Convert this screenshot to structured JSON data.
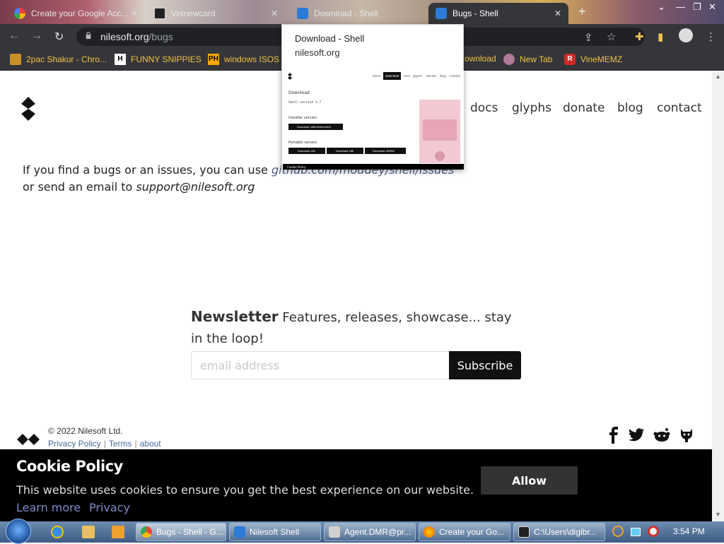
{
  "browser": {
    "tabs": [
      {
        "label": "Create your Google Acc...",
        "icon": "google-icon"
      },
      {
        "label": "Vetnewcard",
        "icon": "card-icon"
      },
      {
        "label": "Download - Shell",
        "icon": "shell-icon"
      },
      {
        "label": "Bugs - Shell",
        "icon": "shell-icon",
        "active": true
      }
    ],
    "url_host": "nilesoft.org",
    "url_path": "/bugs",
    "bookmarks": [
      {
        "label": "2pac Shakur - Chro...",
        "icon": "bookmark-icon"
      },
      {
        "label": "FUNNY SNIPPIES",
        "icon": "h-icon",
        "glyph": "H"
      },
      {
        "label": "windows ISOS",
        "icon": "ph-icon",
        "glyph": "PH"
      },
      {
        "label": "ownload",
        "icon": "bookmark-icon"
      },
      {
        "label": "New Tab",
        "icon": "newtab-icon"
      },
      {
        "label": "VineMEMZ",
        "icon": "r-icon",
        "glyph": "R"
      }
    ]
  },
  "preview": {
    "title": "Download - Shell",
    "host": "nilesoft.org",
    "thumb": {
      "nav": [
        "home",
        "download",
        "docs",
        "glyphs",
        "donate",
        "blog",
        "contact"
      ],
      "heading": "Download",
      "version": "Shell version 1.7",
      "installer_label": "Installer version",
      "installer_btn": "Download (x86/x64/arm64)",
      "portable_label": "Portable version",
      "portable_btns": [
        "Download x64",
        "Download x86",
        "Download ARM64"
      ],
      "cookie": "Cookie Policy"
    }
  },
  "site": {
    "nav": [
      "docs",
      "glyphs",
      "donate",
      "blog",
      "contact"
    ],
    "bug_text_1": "If you find a bugs or an issues, you can use ",
    "bug_link": "github.com/moudey/shell/issues",
    "bug_text_2": "or send an email to ",
    "bug_email": "support@nilesoft.org",
    "newsletter_title": "Newsletter",
    "newsletter_text": " Features, releases, showcase... stay in the loop!",
    "email_placeholder": "email address",
    "subscribe_label": "Subscribe",
    "copyright": "© 2022 Nilesoft Ltd.",
    "footer_links": [
      "Privacy Policy",
      "Terms",
      "about"
    ],
    "social": [
      "facebook-icon",
      "twitter-icon",
      "reddit-icon",
      "github-icon"
    ]
  },
  "cookie": {
    "title": "Cookie Policy",
    "message": "This website uses cookies to ensure you get the best experience on our website.",
    "learn_more": "Learn more",
    "privacy": "Privacy",
    "allow": "Allow"
  },
  "taskbar": {
    "tasks": [
      {
        "label": "Bugs - Shell - G...",
        "color": "#dd4b39",
        "active": true
      },
      {
        "label": "Nilesoft Shell",
        "color": "#2b7bd8"
      },
      {
        "label": "Agent.DMR@pr...",
        "color": "#d0d0d0"
      },
      {
        "label": "Create your Go...",
        "color": "#e66000"
      },
      {
        "label": "C:\\Users\\digibr...",
        "color": "#222222"
      }
    ],
    "clock": "3:54 PM"
  }
}
